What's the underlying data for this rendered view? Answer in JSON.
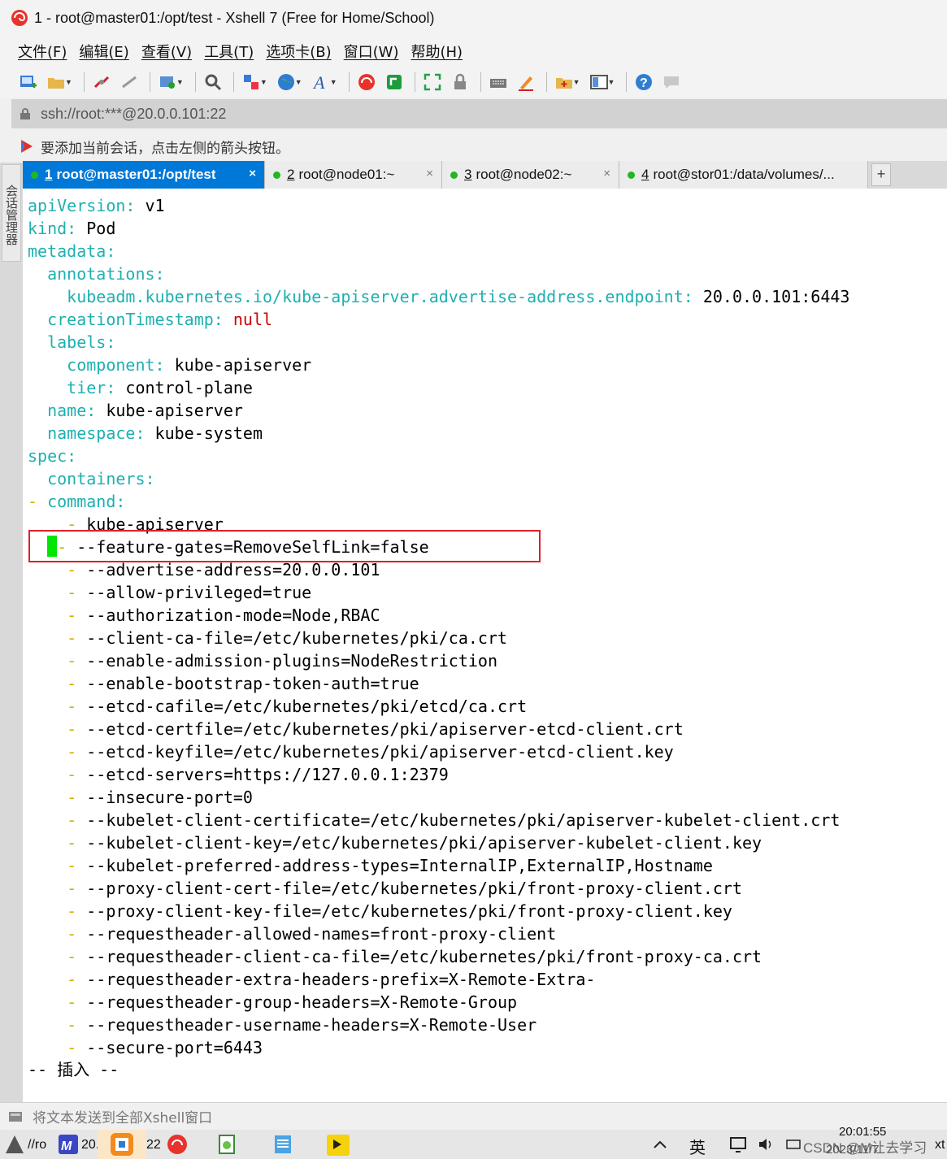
{
  "window": {
    "title": "1 - root@master01:/opt/test - Xshell 7 (Free for Home/School)"
  },
  "menu": {
    "items": [
      "文件(F)",
      "编辑(E)",
      "查看(V)",
      "工具(T)",
      "选项卡(B)",
      "窗口(W)",
      "帮助(H)"
    ]
  },
  "toolbar": {
    "icons": [
      "new-session-icon",
      "open-folder-icon",
      "disconnect-icon",
      "reconnect-icon",
      "properties-icon",
      "find-icon",
      "transfer-icon",
      "globe-icon",
      "font-icon",
      "xshell-icon",
      "xftp-icon",
      "fullscreen-icon",
      "lock-icon",
      "keyboard-icon",
      "highlight-icon",
      "add-tab-icon",
      "layout-icon",
      "help-icon",
      "chat-icon"
    ]
  },
  "address": {
    "url": "ssh://root:***@20.0.0.101:22"
  },
  "hint": {
    "text": "要添加当前会话，点击左侧的箭头按钮。"
  },
  "side_panel": {
    "label": "会话管理器"
  },
  "tabs": [
    {
      "number": "1",
      "label": "root@master01:/opt/test",
      "active": true
    },
    {
      "number": "2",
      "label": "root@node01:~",
      "active": false
    },
    {
      "number": "3",
      "label": "root@node02:~",
      "active": false
    },
    {
      "number": "4",
      "label": "root@stor01:/data/volumes/...",
      "active": false
    }
  ],
  "tab_add_label": "+",
  "tab_close_glyph": "×",
  "terminal": {
    "lines": [
      {
        "key": "apiVersion",
        "value": "v1",
        "indent": 0
      },
      {
        "key": "kind",
        "value": "Pod",
        "indent": 0
      },
      {
        "key": "metadata",
        "indent": 0
      },
      {
        "key": "annotations",
        "indent": 1
      },
      {
        "key": "kubeadm.kubernetes.io/kube-apiserver.advertise-address.endpoint",
        "value": "20.0.0.101:6443",
        "indent": 2
      },
      {
        "key": "creationTimestamp",
        "value": "null",
        "value_style": "null",
        "indent": 1
      },
      {
        "key": "labels",
        "indent": 1
      },
      {
        "key": "component",
        "value": "kube-apiserver",
        "indent": 2
      },
      {
        "key": "tier",
        "value": "control-plane",
        "indent": 2
      },
      {
        "key": "name",
        "value": "kube-apiserver",
        "indent": 1
      },
      {
        "key": "namespace",
        "value": "kube-system",
        "indent": 1
      },
      {
        "key": "spec",
        "indent": 0
      },
      {
        "key": "containers",
        "indent": 1
      },
      {
        "key": "command",
        "indent": 1,
        "dash": true
      },
      {
        "item": "kube-apiserver",
        "indent": 2
      },
      {
        "item": "--feature-gates=RemoveSelfLink=false",
        "indent": 2,
        "cursor": true
      },
      {
        "item": "--advertise-address=20.0.0.101",
        "indent": 2
      },
      {
        "item": "--allow-privileged=true",
        "indent": 2
      },
      {
        "item": "--authorization-mode=Node,RBAC",
        "indent": 2
      },
      {
        "item": "--client-ca-file=/etc/kubernetes/pki/ca.crt",
        "indent": 2
      },
      {
        "item": "--enable-admission-plugins=NodeRestriction",
        "indent": 2
      },
      {
        "item": "--enable-bootstrap-token-auth=true",
        "indent": 2
      },
      {
        "item": "--etcd-cafile=/etc/kubernetes/pki/etcd/ca.crt",
        "indent": 2
      },
      {
        "item": "--etcd-certfile=/etc/kubernetes/pki/apiserver-etcd-client.crt",
        "indent": 2
      },
      {
        "item": "--etcd-keyfile=/etc/kubernetes/pki/apiserver-etcd-client.key",
        "indent": 2
      },
      {
        "item": "--etcd-servers=https://127.0.0.1:2379",
        "indent": 2
      },
      {
        "item": "--insecure-port=0",
        "indent": 2
      },
      {
        "item": "--kubelet-client-certificate=/etc/kubernetes/pki/apiserver-kubelet-client.crt",
        "indent": 2
      },
      {
        "item": "--kubelet-client-key=/etc/kubernetes/pki/apiserver-kubelet-client.key",
        "indent": 2
      },
      {
        "item": "--kubelet-preferred-address-types=InternalIP,ExternalIP,Hostname",
        "indent": 2
      },
      {
        "item": "--proxy-client-cert-file=/etc/kubernetes/pki/front-proxy-client.crt",
        "indent": 2
      },
      {
        "item": "--proxy-client-key-file=/etc/kubernetes/pki/front-proxy-client.key",
        "indent": 2
      },
      {
        "item": "--requestheader-allowed-names=front-proxy-client",
        "indent": 2
      },
      {
        "item": "--requestheader-client-ca-file=/etc/kubernetes/pki/front-proxy-ca.crt",
        "indent": 2
      },
      {
        "item": "--requestheader-extra-headers-prefix=X-Remote-Extra-",
        "indent": 2
      },
      {
        "item": "--requestheader-group-headers=X-Remote-Group",
        "indent": 2
      },
      {
        "item": "--requestheader-username-headers=X-Remote-User",
        "indent": 2
      },
      {
        "item": "--secure-port=6443",
        "indent": 2
      }
    ],
    "status_line": "-- 插入 --",
    "colors": {
      "key": "#1fb0b0",
      "value": "#000000",
      "null": "#cc0000",
      "dash": "#cdb200",
      "cursor": "#00e600",
      "highlight_box": "#e0202a"
    }
  },
  "sendbar": {
    "text": "将文本发送到全部Xshell窗口"
  },
  "taskbar": {
    "left_text": "//ro",
    "mid_text_a": "20.",
    "mid_text_b": "22",
    "ime": "英",
    "clock_time": "20:01:55",
    "clock_date": "2023/11/7",
    "watermark": "CSDN @M让去学习",
    "tail": "xt"
  }
}
